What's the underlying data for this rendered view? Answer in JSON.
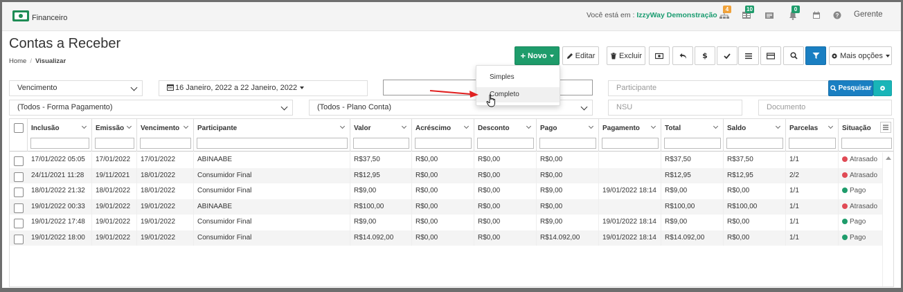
{
  "topbar": {
    "module_title": "Financeiro",
    "you_are_in": "Você está em :",
    "company": "IzzyWay Demonstração",
    "badges": [
      "4",
      "10",
      "0"
    ],
    "badge_colors": [
      "#f0a23a",
      "#1e9c6b",
      "#1e9c6b"
    ],
    "user": "Gerente",
    "icons": [
      "sitemap-icon",
      "store-icon",
      "id-card-icon",
      "bell-icon",
      "calendar-icon",
      "help-icon"
    ]
  },
  "page": {
    "title": "Contas a Receber",
    "breadcrumb": [
      "Home",
      "Visualizar"
    ]
  },
  "toolbar": {
    "new_label": "Novo",
    "new_icon": "+",
    "edit_label": "Editar",
    "delete_label": "Excluir",
    "more_label": "Mais opções",
    "icons": [
      "money-icon",
      "undo-icon",
      "dollar-icon",
      "check-icon",
      "list-icon",
      "card-icon",
      "search-icon",
      "filter-icon"
    ],
    "dollar_glyph": "$"
  },
  "new_menu": {
    "items": [
      "Simples",
      "Completo"
    ]
  },
  "filters": {
    "date_type": "Vencimento",
    "date_range": "16 Janeiro, 2022 a 22 Janeiro, 2022",
    "search_value": "",
    "participante_placeholder": "Participante",
    "search_button": "Pesquisar",
    "forma_pagamento": "(Todos - Forma Pagamento)",
    "plano_conta": "(Todos - Plano Conta)",
    "nsu_placeholder": "NSU",
    "documento_placeholder": "Documento"
  },
  "table": {
    "columns": [
      "Inclusão",
      "Emissão",
      "Vencimento",
      "Participante",
      "Valor",
      "Acréscimo",
      "Desconto",
      "Pago",
      "Pagamento",
      "Total",
      "Saldo",
      "Parcelas",
      "Situação"
    ],
    "status_colors": {
      "Atrasado": "#e04a55",
      "Pago": "#1e9c6b"
    },
    "rows": [
      [
        "17/01/2022 05:05",
        "17/01/2022",
        "17/01/2022",
        "ABINAABE",
        "R$37,50",
        "R$0,00",
        "R$0,00",
        "R$0,00",
        "",
        "R$37,50",
        "R$37,50",
        "1/1",
        "Atrasado"
      ],
      [
        "24/11/2021 11:28",
        "19/11/2021",
        "18/01/2022",
        "Consumidor Final",
        "R$12,95",
        "R$0,00",
        "R$0,00",
        "R$0,00",
        "",
        "R$12,95",
        "R$12,95",
        "2/2",
        "Atrasado"
      ],
      [
        "18/01/2022 21:32",
        "18/01/2022",
        "18/01/2022",
        "Consumidor Final",
        "R$9,00",
        "R$0,00",
        "R$0,00",
        "R$9,00",
        "19/01/2022 18:14",
        "R$9,00",
        "R$0,00",
        "1/1",
        "Pago"
      ],
      [
        "19/01/2022 00:33",
        "19/01/2022",
        "19/01/2022",
        "ABINAABE",
        "R$100,00",
        "R$0,00",
        "R$0,00",
        "R$0,00",
        "",
        "R$100,00",
        "R$100,00",
        "1/1",
        "Atrasado"
      ],
      [
        "19/01/2022 17:48",
        "19/01/2022",
        "19/01/2022",
        "Consumidor Final",
        "R$9,00",
        "R$0,00",
        "R$0,00",
        "R$9,00",
        "19/01/2022 18:14",
        "R$9,00",
        "R$0,00",
        "1/1",
        "Pago"
      ],
      [
        "19/01/2022 18:00",
        "19/01/2022",
        "19/01/2022",
        "Consumidor Final",
        "R$14.092,00",
        "R$0,00",
        "R$0,00",
        "R$14.092,00",
        "19/01/2022 18:14",
        "R$14.092,00",
        "R$0,00",
        "1/1",
        "Pago"
      ]
    ]
  }
}
